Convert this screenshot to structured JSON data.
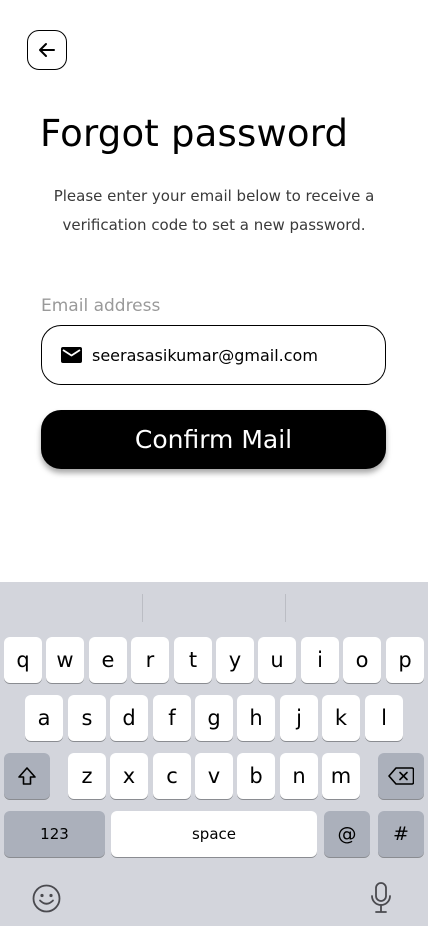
{
  "header": {
    "title": "Forgot password",
    "subtitle_line1": "Please enter your email below to receive a",
    "subtitle_line2": "verification code to set a new password."
  },
  "form": {
    "email_label": "Email address",
    "email_value": "seerasasikumar@gmail.com",
    "confirm_label": "Confirm Mail"
  },
  "keyboard": {
    "row1": [
      "q",
      "w",
      "e",
      "r",
      "t",
      "y",
      "u",
      "i",
      "o",
      "p"
    ],
    "row2": [
      "a",
      "s",
      "d",
      "f",
      "g",
      "h",
      "j",
      "k",
      "l"
    ],
    "row3": [
      "z",
      "x",
      "c",
      "v",
      "b",
      "n",
      "m"
    ],
    "numbers_label": "123",
    "space_label": "space",
    "at_label": "@",
    "hash_label": "#",
    "icons": [
      "shift-icon",
      "backspace-icon",
      "emoji-icon",
      "microphone-icon"
    ]
  },
  "colors": {
    "primary": "#000000",
    "keyboard_bg": "#d3d5dc",
    "key_dark": "#abb0bb",
    "muted_label": "#9a9a9a"
  }
}
